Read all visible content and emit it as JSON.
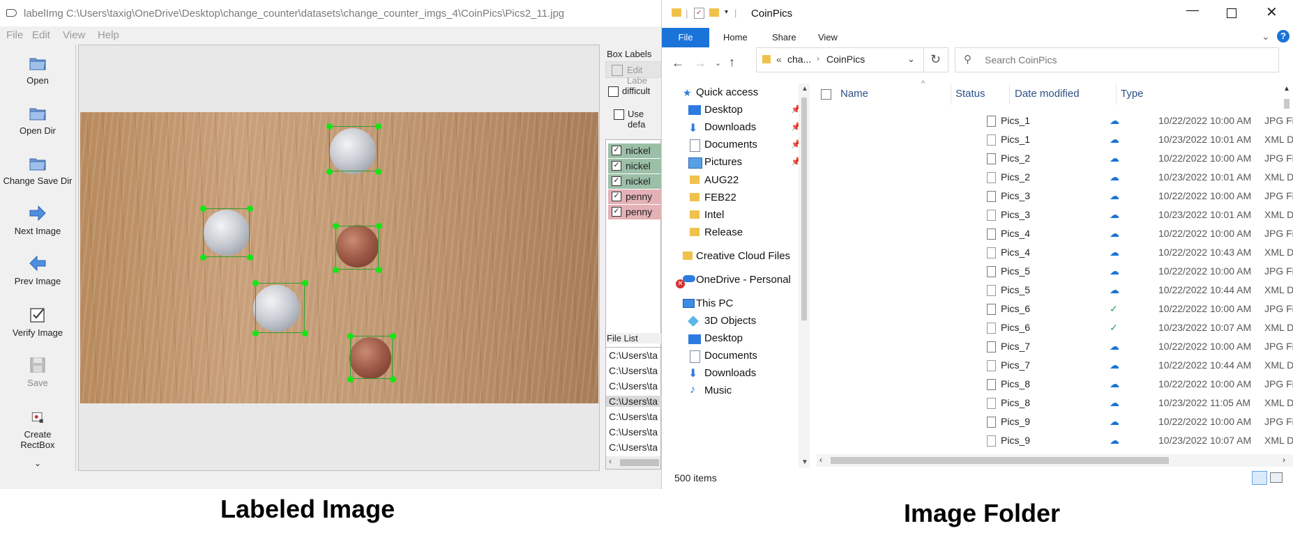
{
  "labelimg": {
    "title": "labelImg C:\\Users\\taxig\\OneDrive\\Desktop\\change_counter\\datasets\\change_counter_imgs_4\\CoinPics\\Pics2_11.jpg",
    "menu": [
      "File",
      "Edit",
      "View",
      "Help"
    ],
    "tools": [
      {
        "label": "Open",
        "icon": "folder-icon"
      },
      {
        "label": "Open Dir",
        "icon": "folder-icon"
      },
      {
        "label": "Change Save Dir",
        "icon": "folder-icon"
      },
      {
        "label": "Next Image",
        "icon": "arrow-right-icon"
      },
      {
        "label": "Prev Image",
        "icon": "arrow-left-icon"
      },
      {
        "label": "Verify Image",
        "icon": "checkbox-icon"
      },
      {
        "label": "Save",
        "icon": "save-icon"
      },
      {
        "label": "Create\nRectBox",
        "icon": "rectbox-icon"
      }
    ],
    "more_glyph": "⌄",
    "box_labels_title": "Box Labels",
    "edit_label_button": "Edit Labe",
    "difficult_label": "difficult",
    "use_default_label": "Use defa",
    "labels": [
      {
        "name": "nickel",
        "checked": true,
        "color": "#9bbfa7"
      },
      {
        "name": "nickel",
        "checked": true,
        "color": "#9bbfa7"
      },
      {
        "name": "nickel",
        "checked": true,
        "color": "#9bbfa7"
      },
      {
        "name": "penny",
        "checked": true,
        "color": "#e3b1b6"
      },
      {
        "name": "penny",
        "checked": true,
        "color": "#e3b1b6"
      }
    ],
    "file_list_title": "File List",
    "file_list": [
      "C:\\Users\\ta",
      "C:\\Users\\ta",
      "C:\\Users\\ta",
      "C:\\Users\\ta",
      "C:\\Users\\ta",
      "C:\\Users\\ta",
      "C:\\Users\\ta"
    ],
    "file_list_selected_index": 3
  },
  "explorer": {
    "title": "CoinPics",
    "ribbon_tabs": [
      "File",
      "Home",
      "Share",
      "View"
    ],
    "address": {
      "prefix": "«",
      "crumb1": "cha...",
      "crumb2": "CoinPics"
    },
    "search_placeholder": "Search CoinPics",
    "columns": [
      "Name",
      "Status",
      "Date modified",
      "Type"
    ],
    "nav": {
      "quick_access": "Quick access",
      "pinned": [
        "Desktop",
        "Downloads",
        "Documents",
        "Pictures"
      ],
      "folders": [
        "AUG22",
        "FEB22",
        "Intel",
        "Release"
      ],
      "creative_cloud": "Creative Cloud Files",
      "onedrive": "OneDrive - Personal",
      "this_pc": "This PC",
      "pc_items": [
        "3D Objects",
        "Desktop",
        "Documents",
        "Downloads",
        "Music"
      ]
    },
    "files": [
      {
        "name": "Pics_1",
        "status": "cloud",
        "date": "10/22/2022 10:00 AM",
        "type": "JPG File"
      },
      {
        "name": "Pics_1",
        "status": "cloud",
        "date": "10/23/2022 10:01 AM",
        "type": "XML Document"
      },
      {
        "name": "Pics_2",
        "status": "cloud",
        "date": "10/22/2022 10:00 AM",
        "type": "JPG File"
      },
      {
        "name": "Pics_2",
        "status": "cloud",
        "date": "10/23/2022 10:01 AM",
        "type": "XML Document"
      },
      {
        "name": "Pics_3",
        "status": "cloud",
        "date": "10/22/2022 10:00 AM",
        "type": "JPG File"
      },
      {
        "name": "Pics_3",
        "status": "cloud",
        "date": "10/23/2022 10:01 AM",
        "type": "XML Document"
      },
      {
        "name": "Pics_4",
        "status": "cloud",
        "date": "10/22/2022 10:00 AM",
        "type": "JPG File"
      },
      {
        "name": "Pics_4",
        "status": "cloud",
        "date": "10/22/2022 10:43 AM",
        "type": "XML Document"
      },
      {
        "name": "Pics_5",
        "status": "cloud",
        "date": "10/22/2022 10:00 AM",
        "type": "JPG File"
      },
      {
        "name": "Pics_5",
        "status": "cloud",
        "date": "10/22/2022 10:44 AM",
        "type": "XML Document"
      },
      {
        "name": "Pics_6",
        "status": "synced",
        "date": "10/22/2022 10:00 AM",
        "type": "JPG File"
      },
      {
        "name": "Pics_6",
        "status": "synced",
        "date": "10/23/2022 10:07 AM",
        "type": "XML Document"
      },
      {
        "name": "Pics_7",
        "status": "cloud",
        "date": "10/22/2022 10:00 AM",
        "type": "JPG File"
      },
      {
        "name": "Pics_7",
        "status": "cloud",
        "date": "10/22/2022 10:44 AM",
        "type": "XML Document"
      },
      {
        "name": "Pics_8",
        "status": "cloud",
        "date": "10/22/2022 10:00 AM",
        "type": "JPG File"
      },
      {
        "name": "Pics_8",
        "status": "cloud",
        "date": "10/23/2022 11:05 AM",
        "type": "XML Document"
      },
      {
        "name": "Pics_9",
        "status": "cloud",
        "date": "10/22/2022 10:00 AM",
        "type": "JPG File"
      },
      {
        "name": "Pics_9",
        "status": "cloud",
        "date": "10/23/2022 10:07 AM",
        "type": "XML Document"
      }
    ],
    "item_count": "500 items"
  },
  "captions": {
    "left": "Labeled Image",
    "right": "Image Folder"
  },
  "colors": {
    "accent": "#1a73d9",
    "cloud_status": "#1a73d9",
    "synced_status": "#2e9e4f",
    "handle": "#14e614"
  }
}
